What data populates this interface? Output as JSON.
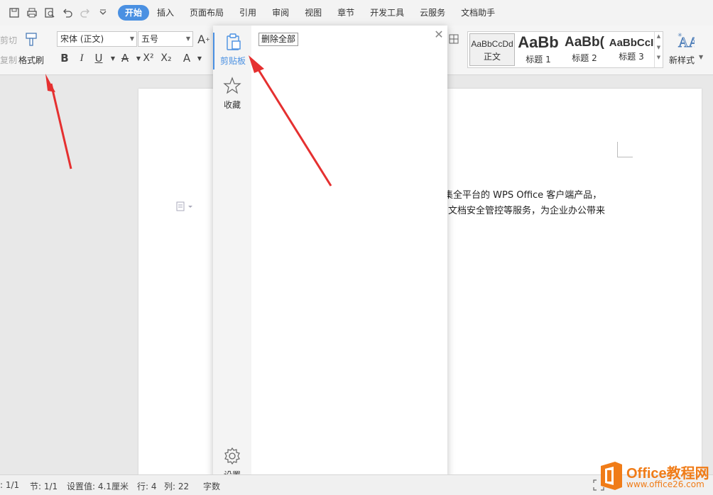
{
  "menubar": {
    "quick_access": [
      "save-icon",
      "print-icon",
      "print-preview-icon",
      "undo-icon",
      "redo-icon",
      "customize-icon"
    ],
    "tabs": [
      {
        "label": "开始",
        "active": true
      },
      {
        "label": "插入"
      },
      {
        "label": "页面布局"
      },
      {
        "label": "引用"
      },
      {
        "label": "审阅"
      },
      {
        "label": "视图"
      },
      {
        "label": "章节"
      },
      {
        "label": "开发工具"
      },
      {
        "label": "云服务"
      },
      {
        "label": "文档助手"
      }
    ]
  },
  "ribbon": {
    "cut_label": "剪切",
    "copy_label": "复制",
    "format_painter_label": "格式刷",
    "font_name": "宋体 (正文)",
    "font_size": "五号",
    "bold": "B",
    "italic": "I",
    "underline": "U",
    "strike": "A",
    "superscript": "X²",
    "subscript": "X₂",
    "text_effect": "A",
    "styles": [
      {
        "sample": "AaBbCcDd",
        "name": "正文"
      },
      {
        "sample": "AaBb",
        "name": "标题 1"
      },
      {
        "sample": "AaBb(",
        "name": "标题 2"
      },
      {
        "sample": "AaBbCcI",
        "name": "标题 3"
      }
    ],
    "new_style_label": "新样式"
  },
  "document": {
    "line1": "集全平台的 WPS Office 客户端产品，",
    "line2": "文档安全管控等服务，为企业办公带来"
  },
  "clipboard_panel": {
    "tabs": [
      {
        "label": "剪贴板",
        "icon": "clipboard-icon",
        "active": true
      },
      {
        "label": "收藏",
        "icon": "star-icon"
      }
    ],
    "settings_label": "设置",
    "delete_all_label": "删除全部",
    "close_icon": "close-icon"
  },
  "statusbar": {
    "page": ": 1/1",
    "section": "节: 1/1",
    "setting": "设置值: 4.1厘米",
    "row": "行: 4",
    "col": "列: 22",
    "wordcount": "字数"
  },
  "watermark": {
    "title": "Office教程网",
    "url": "www.office26.com"
  },
  "colors": {
    "accent": "#4a90e2",
    "arrow": "#e53030",
    "watermark": "#f07c18"
  }
}
